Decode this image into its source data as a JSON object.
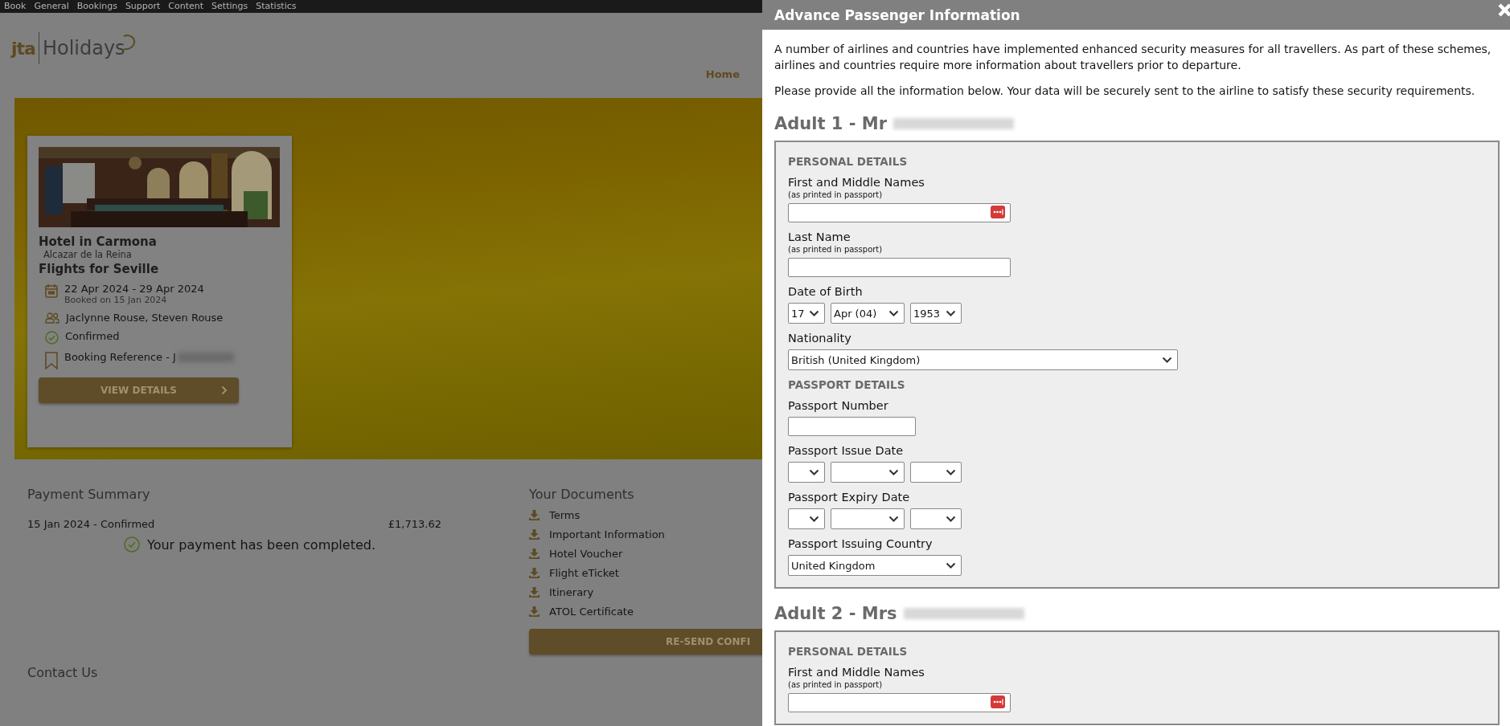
{
  "top_menu": [
    {
      "label": "Book"
    },
    {
      "label": "General"
    },
    {
      "label": "Bookings"
    },
    {
      "label": "Support"
    },
    {
      "label": "Content"
    },
    {
      "label": "Settings"
    },
    {
      "label": "Statistics"
    }
  ],
  "logo": {
    "mark": "jta",
    "name": "Holidays"
  },
  "nav": [
    {
      "label": "Home"
    }
  ],
  "booking_card": {
    "title": "Hotel in Carmona",
    "subtitle": "Alcazar de la Reina",
    "flights": "Flights for Seville",
    "details": [
      {
        "kind": "dates",
        "text": "22 Apr 2024 - 29 Apr 2024",
        "note": "Booked on 15 Jan 2024"
      },
      {
        "kind": "travellers",
        "text": "Jaclynne Rouse, Steven Rouse"
      },
      {
        "kind": "status",
        "text": "Confirmed"
      },
      {
        "kind": "reference",
        "text": "Booking Reference - J",
        "redacted": true
      }
    ],
    "button": "VIEW DETAILS"
  },
  "payment_summary": {
    "title": "Payment Summary",
    "rows": [
      {
        "label": "15 Jan 2024 - Confirmed",
        "amount": "£1,713.62"
      }
    ],
    "message": "Your payment has been completed."
  },
  "documents": {
    "title": "Your Documents",
    "items": [
      {
        "label": "Terms"
      },
      {
        "label": "Important Information"
      },
      {
        "label": "Hotel Voucher"
      },
      {
        "label": "Flight eTicket"
      },
      {
        "label": "Itinerary"
      },
      {
        "label": "ATOL Certificate"
      }
    ],
    "button": "RE-SEND CONFI"
  },
  "contact": {
    "title": "Contact Us"
  },
  "dialog": {
    "title": "Advance Passenger Information",
    "intro": [
      "A number of airlines and countries have implemented enhanced security measures for all travellers. As part of these schemes, airlines and countries require more information about travellers prior to departure.",
      "Please provide all the information below. Your data will be securely sent to the airline to satisfy these security requirements."
    ],
    "passengers": [
      {
        "heading": "Adult 1 - Mr",
        "name_redacted": true,
        "sections": [
          {
            "title": "PERSONAL DETAILS",
            "fields": [
              {
                "kind": "text",
                "label": "First and Middle Names",
                "hint": "(as printed in passport)",
                "autofill_icon": true
              },
              {
                "kind": "text",
                "label": "Last Name",
                "hint": "(as printed in passport)",
                "autofill_icon": false
              },
              {
                "kind": "date",
                "label": "Date of Birth",
                "values": [
                  "17",
                  "Apr (04)",
                  "1953"
                ]
              },
              {
                "kind": "wide_select",
                "label": "Nationality",
                "value": "British (United Kingdom)"
              }
            ]
          },
          {
            "title": "PASSPORT DETAILS",
            "fields": [
              {
                "kind": "short_text",
                "label": "Passport Number"
              },
              {
                "kind": "date",
                "label": "Passport Issue Date"
              },
              {
                "kind": "date",
                "label": "Passport Expiry Date"
              },
              {
                "kind": "select",
                "label": "Passport Issuing Country",
                "value": "United Kingdom"
              }
            ]
          }
        ]
      },
      {
        "heading": "Adult 2 - Mrs",
        "name_redacted": true,
        "sections": [
          {
            "title": "PERSONAL DETAILS",
            "fields": [
              {
                "kind": "text",
                "label": "First and Middle Names",
                "hint": "(as printed in passport)",
                "autofill_icon": true
              }
            ]
          }
        ]
      }
    ]
  }
}
